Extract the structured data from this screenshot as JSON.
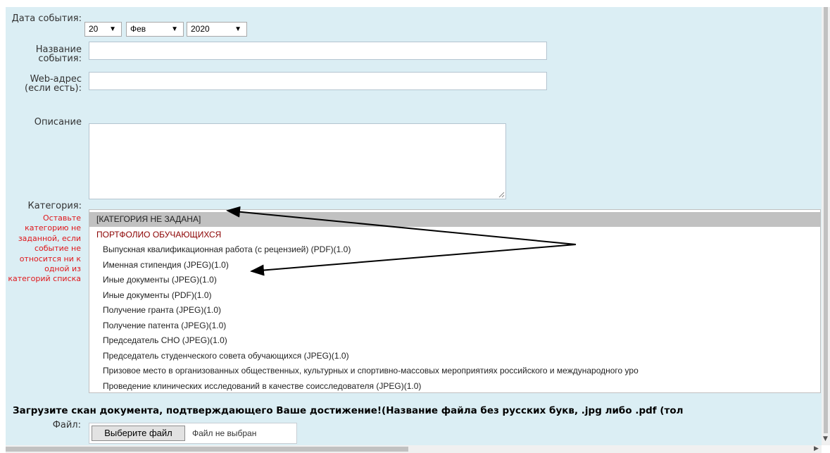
{
  "form": {
    "date_label": "Дата события:",
    "date_day": "20",
    "date_month": "Фев",
    "date_year": "2020",
    "title_label": "Название события:",
    "url_label": "Web-адрес (если есть):",
    "description_label": "Описание",
    "category_label": "Категория:",
    "category_hint": "Оставьте категорию не заданной, если событие не относится ни к одной из категорий списка",
    "dropdown_arrow": "▼"
  },
  "categories": [
    {
      "label": "[КАТЕГОРИЯ НЕ ЗАДАНА]",
      "selected": true
    },
    {
      "label": "ПОРТФОЛИО ОБУЧАЮЩИХСЯ",
      "group": true
    },
    {
      "label": "Выпускная квалификационная работа (с рецензией) (PDF)(1.0)"
    },
    {
      "label": "Именная стипендия (JPEG)(1.0)"
    },
    {
      "label": "Иные документы (JPEG)(1.0)"
    },
    {
      "label": "Иные документы (PDF)(1.0)"
    },
    {
      "label": "Получение гранта (JPEG)(1.0)"
    },
    {
      "label": "Получение патента (JPEG)(1.0)"
    },
    {
      "label": "Председатель СНО (JPEG)(1.0)"
    },
    {
      "label": "Председатель студенческого совета обучающихся (JPEG)(1.0)"
    },
    {
      "label": "Призовое место в организованных общественных, культурных и спортивно-массовых мероприятиях российского и международного уро"
    },
    {
      "label": "Проведение клинических исследований в качестве соисследователя (JPEG)(1.0)"
    }
  ],
  "upload": {
    "heading": "Загрузите скан документа, подтверждающего Ваше достижение!(Название файла без русских букв, .jpg либо .pdf (тол",
    "file_label": "Файл:",
    "choose_button": "Выберите файл",
    "no_file": "Файл не выбран"
  },
  "colors": {
    "panel_bg": "#dbeef4",
    "hint_red": "#e0161a",
    "group_dark_red": "#8b0000",
    "selected_row": "#c1c1c1"
  }
}
